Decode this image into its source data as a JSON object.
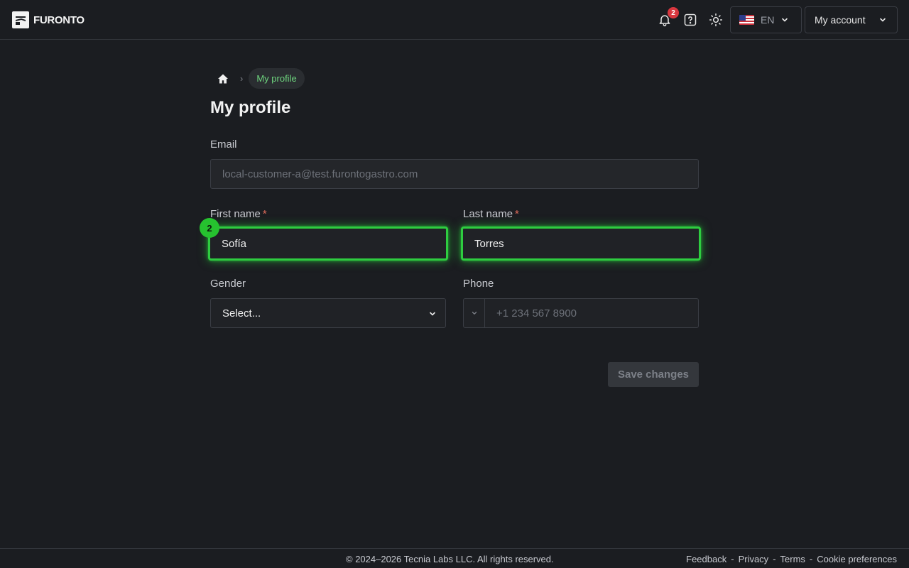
{
  "header": {
    "logo_text": "FURONTO",
    "notification_count": "2",
    "language": "EN",
    "account_label": "My account",
    "icons": [
      "bell-icon",
      "help-icon",
      "sun-icon",
      "us-flag-icon",
      "chevron-down-icon"
    ]
  },
  "breadcrumb": {
    "current": "My profile"
  },
  "page": {
    "title": "My profile"
  },
  "form": {
    "email_label": "Email",
    "email_value": "local-customer-a@test.furontogastro.com",
    "first_name_label": "First name",
    "first_name_value": "Sofía",
    "last_name_label": "Last name",
    "last_name_value": "Torres",
    "required_mark": "*",
    "gender_label": "Gender",
    "gender_value": "Select...",
    "phone_label": "Phone",
    "phone_placeholder": "+1 234 567 8900",
    "save_label": "Save changes"
  },
  "annotation": {
    "marker": "2",
    "highlight_color": "#2ecc40"
  },
  "footer": {
    "copyright": "© 2024–2026 Tecnia Labs LLC. All rights reserved.",
    "links": [
      "Feedback",
      "Privacy",
      "Terms",
      "Cookie preferences"
    ],
    "separator": "-"
  },
  "colors": {
    "background": "#1b1d21",
    "accent": "#6fd67f",
    "badge": "#d9373f",
    "required": "#e06c5b"
  }
}
